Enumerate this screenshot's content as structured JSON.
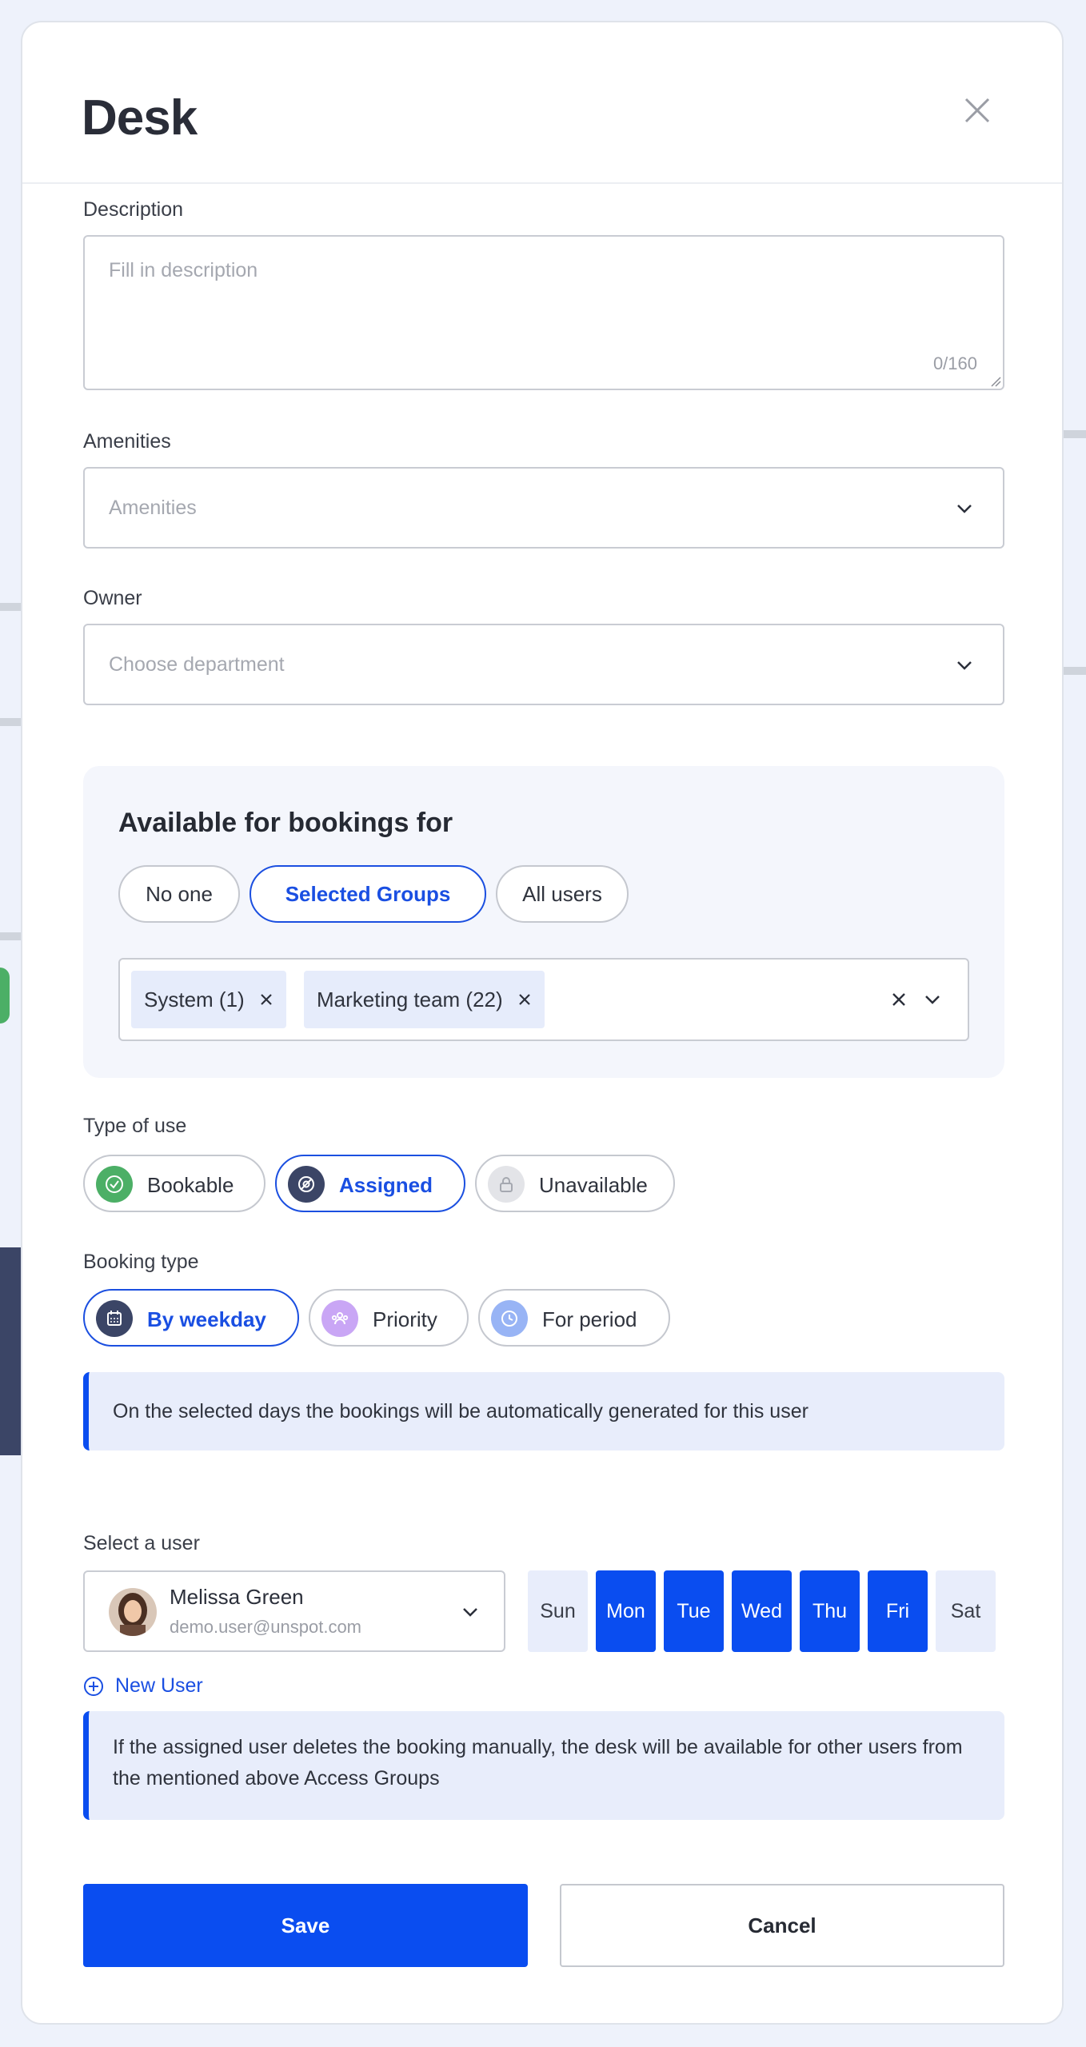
{
  "modal": {
    "title": "Desk"
  },
  "description": {
    "label": "Description",
    "placeholder": "Fill in description",
    "counter": "0/160"
  },
  "amenities": {
    "label": "Amenities",
    "placeholder": "Amenities"
  },
  "owner": {
    "label": "Owner",
    "placeholder": "Choose department"
  },
  "availability": {
    "title": "Available for bookings for",
    "options": [
      "No one",
      "Selected Groups",
      "All users"
    ],
    "selected": "Selected Groups",
    "groups": [
      "System (1)",
      "Marketing team (22)"
    ]
  },
  "type_of_use": {
    "label": "Type of use",
    "options": [
      {
        "label": "Bookable",
        "icon": "check-circle-icon",
        "color": "#4caf66"
      },
      {
        "label": "Assigned",
        "icon": "assigned-icon",
        "color": "#3b4566"
      },
      {
        "label": "Unavailable",
        "icon": "lock-icon",
        "color": "#e3e4e8"
      }
    ],
    "selected": "Assigned"
  },
  "booking_type": {
    "label": "Booking type",
    "options": [
      {
        "label": "By weekday",
        "icon": "calendar-icon",
        "color": "#3b4566"
      },
      {
        "label": "Priority",
        "icon": "group-icon",
        "color": "#c9a6f5"
      },
      {
        "label": "For period",
        "icon": "clock-icon",
        "color": "#98b4f5"
      }
    ],
    "selected": "By weekday"
  },
  "info_weekday": "On the selected days the bookings will be automatically generated for this user",
  "select_user": {
    "label": "Select a user",
    "name": "Melissa Green",
    "email": "demo.user@unspot.com",
    "new_user": "New User"
  },
  "days": [
    {
      "label": "Sun",
      "on": false
    },
    {
      "label": "Mon",
      "on": true
    },
    {
      "label": "Tue",
      "on": true
    },
    {
      "label": "Wed",
      "on": true
    },
    {
      "label": "Thu",
      "on": true
    },
    {
      "label": "Fri",
      "on": true
    },
    {
      "label": "Sat",
      "on": false
    }
  ],
  "info_assigned": "If the assigned user deletes the booking manually, the desk will be available for other users from the mentioned above Access Groups",
  "actions": {
    "save": "Save",
    "cancel": "Cancel"
  },
  "colors": {
    "primary": "#0a4df0",
    "selected_border": "#1b4fe0"
  }
}
